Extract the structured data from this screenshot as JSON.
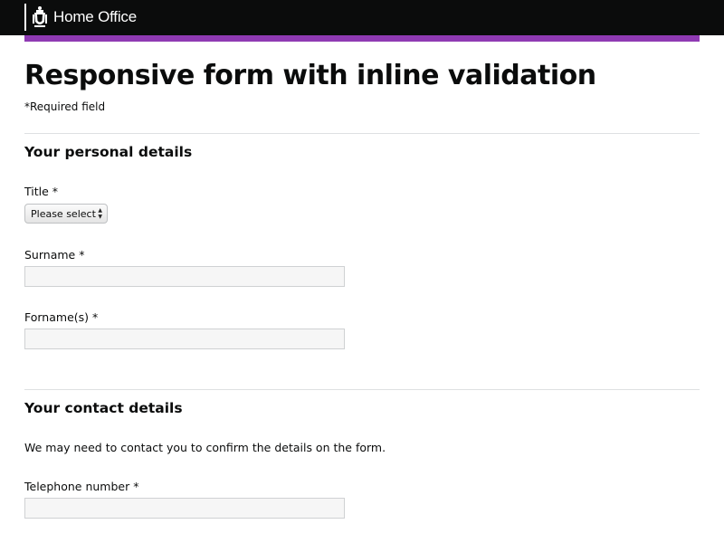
{
  "header": {
    "org_name": "Home Office",
    "crest_icon": "royal-crest-icon",
    "accent_color": "#8f3ab3"
  },
  "page": {
    "title": "Responsive form with inline validation",
    "required_note": "*Required field"
  },
  "personal_details": {
    "heading": "Your personal details",
    "title_label": "Title *",
    "title_select_value": "Please select",
    "surname_label": "Surname *",
    "surname_value": "",
    "forenames_label": "Forname(s) *",
    "forenames_value": ""
  },
  "contact_details": {
    "heading": "Your contact details",
    "intro": "We may need to contact you to confirm the details on the form.",
    "telephone_label": "Telephone number *",
    "telephone_value": ""
  }
}
